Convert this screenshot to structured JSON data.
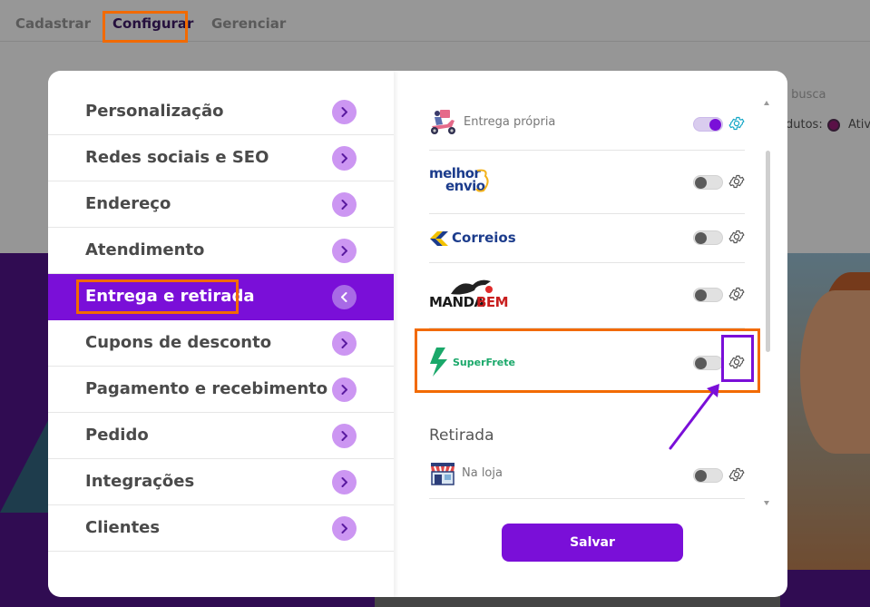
{
  "topnav": {
    "items": [
      {
        "label": "Cadastrar",
        "active": false
      },
      {
        "label": "Configurar",
        "active": true
      },
      {
        "label": "Gerenciar",
        "active": false
      }
    ]
  },
  "background": {
    "search_placeholder_fragment": "a busca",
    "products_label_fragment": "dutos:",
    "active_label_fragment": "Ativ"
  },
  "menu": {
    "items": [
      {
        "label": "Personalização",
        "active": false
      },
      {
        "label": "Redes sociais e SEO",
        "active": false
      },
      {
        "label": "Endereço",
        "active": false
      },
      {
        "label": "Atendimento",
        "active": false
      },
      {
        "label": "Entrega e retirada",
        "active": true
      },
      {
        "label": "Cupons de desconto",
        "active": false
      },
      {
        "label": "Pagamento e recebimento",
        "active": false
      },
      {
        "label": "Pedido",
        "active": false
      },
      {
        "label": "Integrações",
        "active": false
      },
      {
        "label": "Clientes",
        "active": false
      }
    ]
  },
  "shipping": {
    "methods": [
      {
        "name": "Entrega própria",
        "enabled": true,
        "icon": "delivery-scooter-icon"
      },
      {
        "name": "melhor envio",
        "logo_line1": "melhor",
        "logo_line2": "envio",
        "enabled": false,
        "icon": "melhor-envio-logo"
      },
      {
        "name": "Correios",
        "enabled": false,
        "icon": "correios-logo"
      },
      {
        "name": "MANDABEM",
        "logo_a": "MANDA",
        "logo_b": "BEM",
        "enabled": false,
        "icon": "mandabem-logo"
      },
      {
        "name": "SuperFrete",
        "enabled": false,
        "icon": "superfrete-logo"
      }
    ]
  },
  "pickup": {
    "heading": "Retirada",
    "methods": [
      {
        "name": "Na loja",
        "enabled": false,
        "icon": "storefront-icon"
      }
    ]
  },
  "actions": {
    "save_label": "Salvar"
  },
  "colors": {
    "primary": "#7a0fd8",
    "menu_arrow": "#cc96f2",
    "annotation_orange": "#f26a00",
    "gear_active": "#16a7c6"
  }
}
